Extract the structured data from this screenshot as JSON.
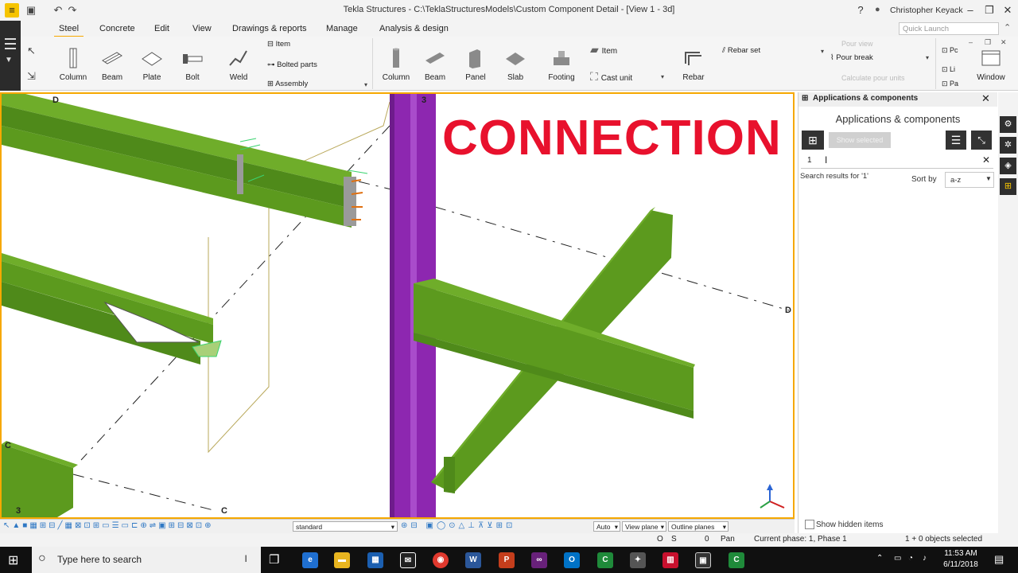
{
  "window": {
    "title": "Tekla Structures - C:\\TeklaStructuresModels\\Custom Component Detail  - [View 1 - 3d]",
    "help": "?",
    "user": "Christopher Keyack"
  },
  "ribbon": {
    "tabs": [
      "Steel",
      "Concrete",
      "Edit",
      "View",
      "Drawings & reports",
      "Manage",
      "Analysis & design"
    ],
    "active_tab": "Steel",
    "quick_launch_placeholder": "Quick Launch",
    "steel": {
      "column": "Column",
      "beam": "Beam",
      "plate": "Plate",
      "bolt": "Bolt",
      "weld": "Weld",
      "item": "Item",
      "bolted_parts": "Bolted parts",
      "assembly": "Assembly"
    },
    "concrete": {
      "column": "Column",
      "beam": "Beam",
      "panel": "Panel",
      "slab": "Slab",
      "footing": "Footing",
      "item": "Item",
      "cast_unit": "Cast unit",
      "rebar": "Rebar",
      "rebar_set": "Rebar set",
      "pour_view": "Pour view",
      "pour_break": "Pour break",
      "calculate_pour_units": "Calculate pour units"
    },
    "window_group": {
      "item1": "Pc",
      "item2": "Li",
      "item3": "Pa",
      "window": "Window"
    }
  },
  "viewport": {
    "overlay_text": "CONNECTION",
    "grid_labels": [
      "D",
      "3",
      "C",
      "3",
      "C",
      "D"
    ]
  },
  "panel": {
    "header": "Applications & components",
    "title": "Applications & components",
    "show_selected": "Show selected",
    "search_value": "1",
    "search_results": "Search results for '1'",
    "sort_label": "Sort by",
    "sort_value": "a-z",
    "show_hidden": "Show hidden items"
  },
  "bottom_toolbar": {
    "view_filter": "standard",
    "snap_mode": "Auto",
    "plane": "View plane",
    "planes_mode": "Outline planes"
  },
  "status": {
    "o": "O",
    "s": "S",
    "zero": "0",
    "mode": "Pan",
    "phase": "Current phase: 1, Phase 1",
    "selected": "1 + 0 objects selected"
  },
  "taskbar": {
    "search_placeholder": "Type here to search",
    "time": "11:53 AM",
    "date": "6/11/2018",
    "apps": [
      "Edge",
      "Explorer",
      "Store",
      "Mail",
      "Chrome",
      "Word",
      "PowerPoint",
      "Visual Studio",
      "Outlook",
      "Camtasia",
      "App",
      "Tekla",
      "Window",
      "Camtasia2"
    ]
  },
  "colors": {
    "accent": "#f6a800",
    "steel_green": "#5c9a1e",
    "column_purple": "#8d27b0",
    "connection_red": "#e8112d"
  }
}
